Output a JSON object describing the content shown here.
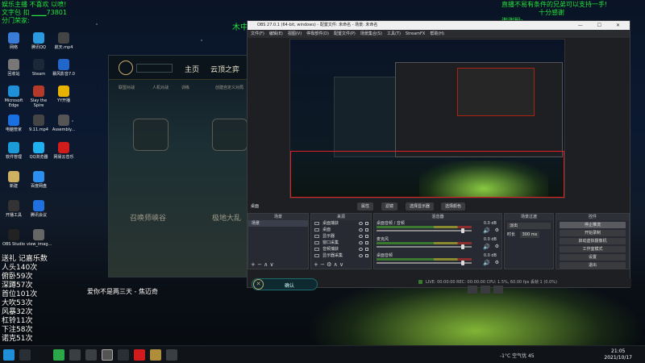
{
  "overlay": {
    "top_left_line1": "娱乐主播 不喜欢 以喷!",
    "top_left_line2": "文字包 扣 ▁▁▁73801",
    "top_left_line3": "分门荣家:",
    "top_center": "木中",
    "top_right_line1": "直播不易有条件的兄弟可以支持一手!",
    "top_right_line2": "十分感谢",
    "top_right_line3": "谢谢粉:"
  },
  "desktop_icons": [
    {
      "label": "网络",
      "color": "#3a7bd5"
    },
    {
      "label": "腾讯QQ",
      "color": "#2a9be0"
    },
    {
      "label": "航天.mp4",
      "color": "#444"
    },
    {
      "label": "回收站",
      "color": "#777"
    },
    {
      "label": "Steam",
      "color": "#1b2838"
    },
    {
      "label": "暴风影音7.0",
      "color": "#2266cc"
    },
    {
      "label": "Microsoft Edge",
      "color": "#1f8fd8"
    },
    {
      "label": "Slay the Spire",
      "color": "#b53a2a"
    },
    {
      "label": "YY开播",
      "color": "#e8b300"
    },
    {
      "label": "电脑管家",
      "color": "#1a70e0"
    },
    {
      "label": "9.11.mp4",
      "color": "#444"
    },
    {
      "label": "Assembly...",
      "color": "#555"
    },
    {
      "label": "软件管理",
      "color": "#1a9ad6"
    },
    {
      "label": "QQ浏览器",
      "color": "#1fb0f0"
    },
    {
      "label": "网易云音乐",
      "color": "#d11c1c"
    },
    {
      "label": "新建",
      "color": "#cdb060"
    },
    {
      "label": "百度网盘",
      "color": "#2b8ff0"
    },
    {
      "label": "开播工具",
      "color": "#333"
    },
    {
      "label": "腾讯会议",
      "color": "#2070e0"
    },
    {
      "label": "OBS Studio",
      "color": "#222"
    },
    {
      "label": "view_imag...",
      "color": "#666"
    }
  ],
  "lol_client": {
    "nav_home": "主页",
    "nav_tft": "云顶之弈",
    "sub_items": [
      "联盟对战",
      "人机对战",
      "训练",
      "创建自定义对局"
    ],
    "mode1_title": "召唤师峡谷",
    "mode2_title": "极地大乱"
  },
  "confirm_button": "确认",
  "song_title": "爱你不是两三天 - 焦迈奇",
  "danmaku": [
    "送礼 记嘉乐数",
    "人头140次",
    "俯卧59次",
    "深蹲57次",
    "首位101次",
    "大吹53次",
    "风暴32次",
    "杠铃11次",
    "下注58次",
    "诺克51次"
  ],
  "obs": {
    "title": "OBS 27.0.1 (64-bit, windows) - 配置文件: 未命名 - 场景: 未命名",
    "menu": [
      "文件(F)",
      "编辑(E)",
      "视图(V)",
      "停靠部件(D)",
      "配置文件(P)",
      "场景集合(S)",
      "工具(T)",
      "StreamFX",
      "帮助(H)"
    ],
    "window_controls": "— ☐ ✕",
    "scene_label": "桌面",
    "toolbar_props": "属性",
    "toolbar_filters": "滤镜",
    "toolbar_source1": "选择显示器",
    "toolbar_source2": "选择颜色",
    "scenes": {
      "header": "场景",
      "items": [
        "场景"
      ]
    },
    "sources": {
      "header": "来源",
      "items": [
        "桌面捕获",
        "桌面",
        "显示器",
        "窗口采集",
        "音频捕获",
        "显示器采集"
      ]
    },
    "mixer": {
      "header": "混音器",
      "channels": [
        {
          "name": "桌面音频 / 音频",
          "db": "0.0 dB"
        },
        {
          "name": "麦克风",
          "db": "0.0 dB"
        },
        {
          "name": "桌面音频",
          "db": "0.0 dB"
        }
      ]
    },
    "transitions": {
      "header": "场景过渡",
      "type": "淡出",
      "duration_label": "时长",
      "duration": "300 ms"
    },
    "controls": {
      "header": "控件",
      "buttons": [
        "停止推流",
        "开始录制",
        "启动虚拟摄像机",
        "工作室模式",
        "设置",
        "退出"
      ]
    },
    "status": "LIVE: 00:00:00   REC: 00:00:00   CPU: 1.5%, 60.00 fps   丢帧 1 (0.0%)"
  },
  "taskbar": {
    "weather": "-1°C 空气优 45",
    "time": "21:05",
    "date": "2021/10/17"
  }
}
